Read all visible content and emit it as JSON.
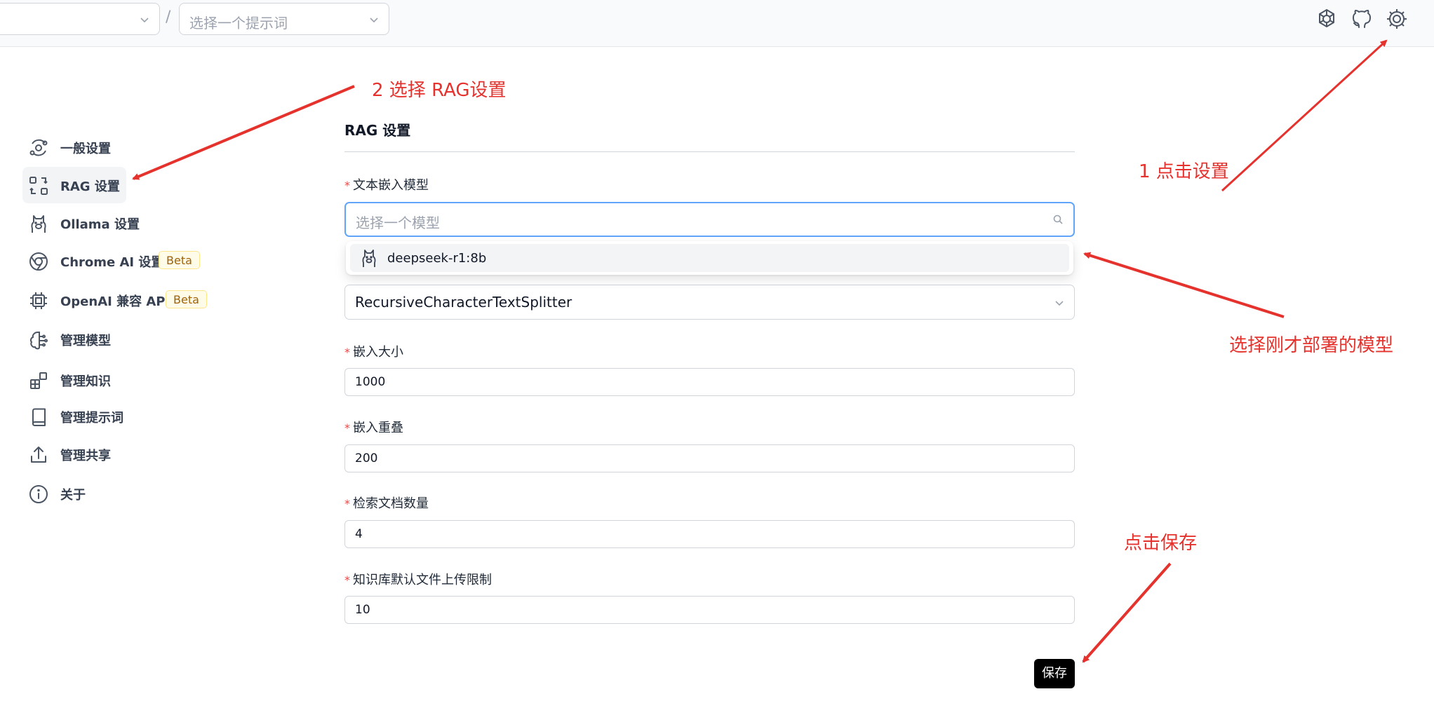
{
  "topbar": {
    "model_select_placeholder": "",
    "separator": "/",
    "prompt_select_placeholder": "选择一个提示词",
    "icons": [
      "openai-icon",
      "github-icon",
      "settings-icon"
    ]
  },
  "sidebar": {
    "items": [
      {
        "label": "一般设置",
        "icon": "orbit-icon",
        "active": false
      },
      {
        "label": "RAG 设置",
        "icon": "rag-icon",
        "active": true
      },
      {
        "label": "Ollama 设置",
        "icon": "llama-icon",
        "active": false
      },
      {
        "label": "Chrome AI 设置",
        "icon": "chrome-icon",
        "badge": "Beta",
        "active": false
      },
      {
        "label": "OpenAI 兼容 API",
        "icon": "cpu-icon",
        "badge": "Beta",
        "active": false
      },
      {
        "label": "管理模型",
        "icon": "brain-icon",
        "active": false
      },
      {
        "label": "管理知识",
        "icon": "blocks-icon",
        "active": false
      },
      {
        "label": "管理提示词",
        "icon": "book-icon",
        "active": false
      },
      {
        "label": "管理共享",
        "icon": "share-icon",
        "active": false
      },
      {
        "label": "关于",
        "icon": "info-icon",
        "active": false
      }
    ]
  },
  "main": {
    "section_title": "RAG 设置",
    "required_mark": "*",
    "embedding_model": {
      "label": "文本嵌入模型",
      "placeholder": "选择一个模型",
      "options": [
        "deepseek-r1:8b"
      ]
    },
    "splitter": {
      "value": "RecursiveCharacterTextSplitter"
    },
    "chunk_size": {
      "label": "嵌入大小",
      "value": "1000"
    },
    "chunk_overlap": {
      "label": "嵌入重叠",
      "value": "200"
    },
    "retrieval_count": {
      "label": "检索文档数量",
      "value": "4"
    },
    "upload_limit": {
      "label": "知识库默认文件上传限制",
      "value": "10"
    },
    "save_label": "保存"
  },
  "annotations": {
    "step1": "1 点击设置",
    "step2": "2 选择 RAG设置",
    "choose_model": "选择刚才部署的模型",
    "click_save": "点击保存"
  },
  "colors": {
    "annotation": "#e5322d",
    "focus_border": "#60a5fa",
    "required": "#ef4444",
    "save_button": "#000000"
  }
}
